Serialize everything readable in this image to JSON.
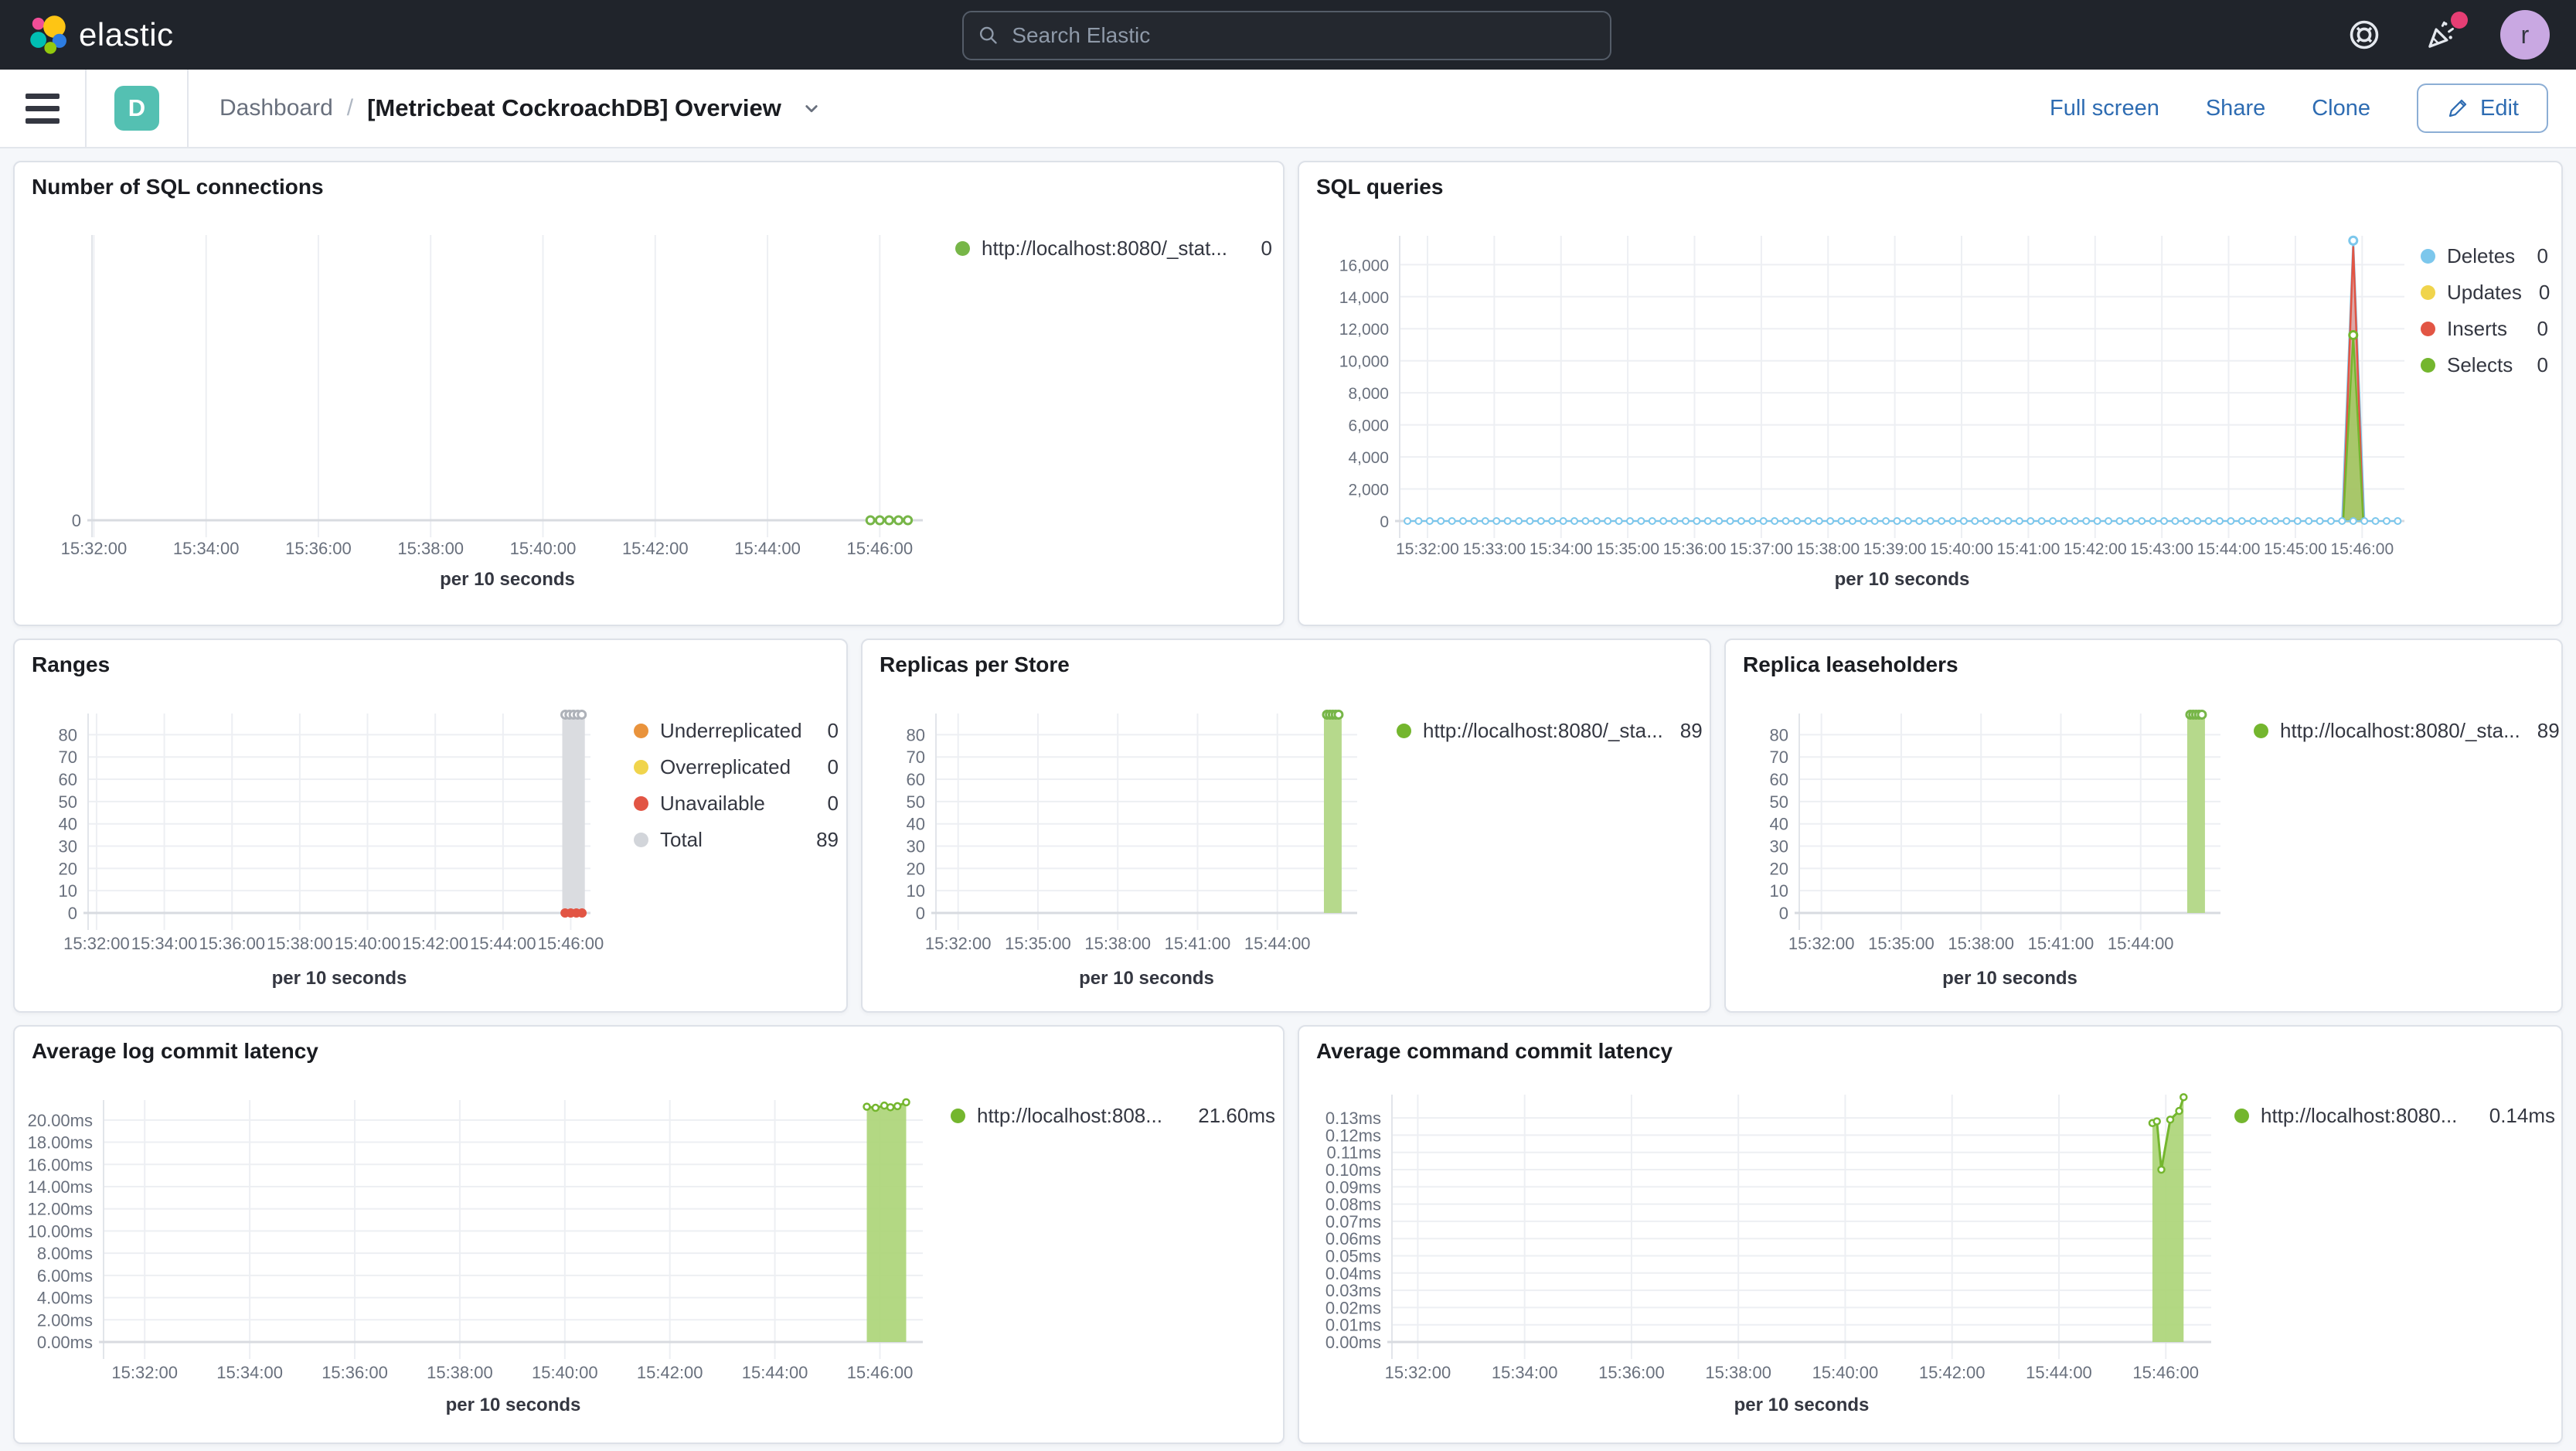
{
  "header": {
    "logo_text": "elastic",
    "search_placeholder": "Search Elastic",
    "avatar_initial": "r"
  },
  "toolbar": {
    "breadcrumb_root": "Dashboard",
    "breadcrumb_sep": "/",
    "dashboard_badge": "D",
    "title": "[Metricbeat CockroachDB] Overview",
    "actions": {
      "full_screen": "Full screen",
      "share": "Share",
      "clone": "Clone",
      "edit": "Edit"
    }
  },
  "colors": {
    "header_bg": "#20242B",
    "accent_teal": "#54C0B2",
    "link_blue": "#2E6CB2",
    "series_green": "#77B648",
    "series_green_fill": "#B6D98C",
    "series_blue": "#7CC7EC",
    "series_yellow": "#F0D44C",
    "series_red": "#E25544",
    "series_orange": "#E9933C",
    "series_gray": "#D2D5DA",
    "notification_pink": "#E63E74",
    "avatar_purple": "#C9A8E2"
  },
  "panels": [
    {
      "id": "sql_connections",
      "row": 0,
      "title": "Number of SQL connections",
      "x_title": "per 10 seconds",
      "chart": {
        "type": "line",
        "x_domain": [
          "15:31:58",
          "15:46:46"
        ],
        "x_ticks": [
          "15:32:00",
          "15:34:00",
          "15:36:00",
          "15:38:00",
          "15:40:00",
          "15:42:00",
          "15:44:00",
          "15:46:00"
        ],
        "y_max": 1,
        "y_ticks": [
          {
            "v": 0,
            "label": "0"
          }
        ],
        "series": [
          {
            "name": "http://localhost:8080/_stat...",
            "type": "scatter",
            "color": "#77B648",
            "ring": true,
            "points": [
              [
                "15:45:50",
                0
              ],
              [
                "15:46:00",
                0
              ],
              [
                "15:46:10",
                0
              ],
              [
                "15:46:20",
                0
              ],
              [
                "15:46:30",
                0
              ]
            ]
          }
        ]
      },
      "legend": [
        {
          "label": "http://localhost:8080/_stat...",
          "color": "#77B648",
          "value": "0"
        }
      ]
    },
    {
      "id": "sql_queries",
      "row": 0,
      "title": "SQL queries",
      "x_title": "per 10 seconds",
      "chart": {
        "type": "line",
        "x_domain": [
          "15:31:35",
          "15:46:38"
        ],
        "x_ticks": [
          "15:32:00",
          "15:33:00",
          "15:34:00",
          "15:35:00",
          "15:36:00",
          "15:37:00",
          "15:38:00",
          "15:39:00",
          "15:40:00",
          "15:41:00",
          "15:42:00",
          "15:43:00",
          "15:44:00",
          "15:45:00",
          "15:46:00"
        ],
        "y_max": 17800,
        "y_ticks": [
          {
            "v": 0,
            "label": "0"
          },
          {
            "v": 2000,
            "label": "2,000"
          },
          {
            "v": 4000,
            "label": "4,000"
          },
          {
            "v": 6000,
            "label": "6,000"
          },
          {
            "v": 8000,
            "label": "8,000"
          },
          {
            "v": 10000,
            "label": "10,000"
          },
          {
            "v": 12000,
            "label": "12,000"
          },
          {
            "v": 14000,
            "label": "14,000"
          },
          {
            "v": 16000,
            "label": "16,000"
          }
        ],
        "series": [
          {
            "name": "Deletes spike",
            "type": "spike",
            "stroke": "#7CC7EC",
            "fill": "#7CC7EC",
            "fill_opacity": 0.3,
            "start": "15:45:42",
            "peak_t": "15:45:52",
            "end": "15:46:02",
            "peak": 17500,
            "marker": true
          },
          {
            "name": "Inserts",
            "type": "spike",
            "stroke": "#E25544",
            "fill": "#E25544",
            "fill_opacity": 0.45,
            "start": "15:45:43",
            "peak_t": "15:45:52",
            "end": "15:46:01",
            "peak": 17100,
            "marker": false
          },
          {
            "name": "Selects",
            "type": "spike",
            "stroke": "#74B62E",
            "fill": "#9FCC5F",
            "fill_opacity": 0.85,
            "start": "15:45:43",
            "peak_t": "15:45:52",
            "end": "15:46:01",
            "peak": 11600,
            "marker": true
          },
          {
            "name": "Deletes baseline",
            "type": "dotline",
            "color": "#7CC7EC",
            "value": 0,
            "from": "15:31:42",
            "to": "15:46:34",
            "step_s": 10
          }
        ]
      },
      "legend": [
        {
          "label": "Deletes",
          "color": "#7CC7EC",
          "value": "0"
        },
        {
          "label": "Updates",
          "color": "#F0D44C",
          "value": "0"
        },
        {
          "label": "Inserts",
          "color": "#E25544",
          "value": "0"
        },
        {
          "label": "Selects",
          "color": "#74B62E",
          "value": "0"
        }
      ]
    },
    {
      "id": "ranges",
      "row": 1,
      "title": "Ranges",
      "x_title": "per 10 seconds",
      "chart": {
        "type": "bar",
        "x_domain": [
          "15:31:45",
          "15:46:35"
        ],
        "x_ticks": [
          "15:32:00",
          "15:34:00",
          "15:36:00",
          "15:38:00",
          "15:40:00",
          "15:42:00",
          "15:44:00",
          "15:46:00"
        ],
        "y_max": 89.5,
        "y_ticks": [
          {
            "v": 0,
            "label": "0"
          },
          {
            "v": 10,
            "label": "10"
          },
          {
            "v": 20,
            "label": "20"
          },
          {
            "v": 30,
            "label": "30"
          },
          {
            "v": 40,
            "label": "40"
          },
          {
            "v": 50,
            "label": "50"
          },
          {
            "v": 60,
            "label": "60"
          },
          {
            "v": 70,
            "label": "70"
          },
          {
            "v": 80,
            "label": "80"
          }
        ],
        "series": [
          {
            "name": "Total",
            "type": "bar",
            "color": "#DADCE0",
            "x_from": "15:45:45",
            "x_to": "15:46:25",
            "value": 89,
            "top_markers": {
              "count": 5,
              "color": "#AEB2B9"
            }
          },
          {
            "name": "Unavailable",
            "type": "scatter",
            "color": "#E25544",
            "solid": true,
            "points": [
              [
                "15:45:50",
                0
              ],
              [
                "15:46:00",
                0
              ],
              [
                "15:46:10",
                0
              ],
              [
                "15:46:20",
                0
              ]
            ]
          }
        ]
      },
      "legend": [
        {
          "label": "Underreplicated",
          "color": "#E9933C",
          "value": "0"
        },
        {
          "label": "Overreplicated",
          "color": "#F0D44C",
          "value": "0"
        },
        {
          "label": "Unavailable",
          "color": "#E25544",
          "value": "0"
        },
        {
          "label": "Total",
          "color": "#D2D5DA",
          "value": "89"
        }
      ]
    },
    {
      "id": "replicas",
      "row": 1,
      "title": "Replicas per Store",
      "x_title": "per 10 seconds",
      "chart": {
        "type": "bar",
        "x_domain": [
          "15:31:10",
          "15:47:00"
        ],
        "x_ticks": [
          "15:32:00",
          "15:35:00",
          "15:38:00",
          "15:41:00",
          "15:44:00"
        ],
        "y_max": 89.5,
        "y_ticks": [
          {
            "v": 0,
            "label": "0"
          },
          {
            "v": 10,
            "label": "10"
          },
          {
            "v": 20,
            "label": "20"
          },
          {
            "v": 30,
            "label": "30"
          },
          {
            "v": 40,
            "label": "40"
          },
          {
            "v": 50,
            "label": "50"
          },
          {
            "v": 60,
            "label": "60"
          },
          {
            "v": 70,
            "label": "70"
          },
          {
            "v": 80,
            "label": "80"
          }
        ],
        "series": [
          {
            "name": "http://localhost:8080/_sta...",
            "type": "bar",
            "color": "#B6D98C",
            "x_from": "15:45:45",
            "x_to": "15:46:25",
            "value": 89,
            "top_markers": {
              "count": 5,
              "color": "#77B648"
            }
          }
        ]
      },
      "legend": [
        {
          "label": "http://localhost:8080/_sta...",
          "color": "#74B62E",
          "value": "89"
        }
      ]
    },
    {
      "id": "leaseholders",
      "row": 1,
      "title": "Replica leaseholders",
      "x_title": "per 10 seconds",
      "chart": {
        "type": "bar",
        "x_domain": [
          "15:31:10",
          "15:47:00"
        ],
        "x_ticks": [
          "15:32:00",
          "15:35:00",
          "15:38:00",
          "15:41:00",
          "15:44:00"
        ],
        "y_max": 89.5,
        "y_ticks": [
          {
            "v": 0,
            "label": "0"
          },
          {
            "v": 10,
            "label": "10"
          },
          {
            "v": 20,
            "label": "20"
          },
          {
            "v": 30,
            "label": "30"
          },
          {
            "v": 40,
            "label": "40"
          },
          {
            "v": 50,
            "label": "50"
          },
          {
            "v": 60,
            "label": "60"
          },
          {
            "v": 70,
            "label": "70"
          },
          {
            "v": 80,
            "label": "80"
          }
        ],
        "series": [
          {
            "name": "http://localhost:8080/_sta...",
            "type": "bar",
            "color": "#B6D98C",
            "x_from": "15:45:45",
            "x_to": "15:46:25",
            "value": 89,
            "top_markers": {
              "count": 5,
              "color": "#77B648"
            }
          }
        ]
      },
      "legend": [
        {
          "label": "http://localhost:8080/_sta...",
          "color": "#74B62E",
          "value": "89"
        }
      ]
    },
    {
      "id": "log_latency",
      "row": 2,
      "title": "Average log commit latency",
      "x_title": "per 10 seconds",
      "chart": {
        "type": "area",
        "x_domain": [
          "15:31:13",
          "15:46:49"
        ],
        "x_ticks": [
          "15:32:00",
          "15:34:00",
          "15:36:00",
          "15:38:00",
          "15:40:00",
          "15:42:00",
          "15:44:00",
          "15:46:00"
        ],
        "y_max": 21.8,
        "y_ticks": [
          {
            "v": 0,
            "label": "0.00ms"
          },
          {
            "v": 2,
            "label": "2.00ms"
          },
          {
            "v": 4,
            "label": "4.00ms"
          },
          {
            "v": 6,
            "label": "6.00ms"
          },
          {
            "v": 8,
            "label": "8.00ms"
          },
          {
            "v": 10,
            "label": "10.00ms"
          },
          {
            "v": 12,
            "label": "12.00ms"
          },
          {
            "v": 14,
            "label": "14.00ms"
          },
          {
            "v": 16,
            "label": "16.00ms"
          },
          {
            "v": 18,
            "label": "18.00ms"
          },
          {
            "v": 20,
            "label": "20.00ms"
          }
        ],
        "series": [
          {
            "name": "http://localhost:808...",
            "type": "area_line",
            "stroke": "#74B62E",
            "fill": "#ABD476",
            "fill_opacity": 0.9,
            "ring": true,
            "points": [
              [
                "15:45:45",
                21.2
              ],
              [
                "15:45:55",
                21.1
              ],
              [
                "15:46:05",
                21.3
              ],
              [
                "15:46:12",
                21.15
              ],
              [
                "15:46:20",
                21.25
              ],
              [
                "15:46:30",
                21.6
              ]
            ]
          }
        ]
      },
      "legend": [
        {
          "label": "http://localhost:808...",
          "color": "#74B62E",
          "value": "21.60ms"
        }
      ]
    },
    {
      "id": "cmd_latency",
      "row": 2,
      "title": "Average command commit latency",
      "x_title": "per 10 seconds",
      "chart": {
        "type": "area",
        "x_domain": [
          "15:31:31",
          "15:46:51"
        ],
        "x_ticks": [
          "15:32:00",
          "15:34:00",
          "15:36:00",
          "15:38:00",
          "15:40:00",
          "15:42:00",
          "15:44:00",
          "15:46:00"
        ],
        "y_max": 0.1435,
        "y_ticks": [
          {
            "v": 0,
            "label": "0.00ms"
          },
          {
            "v": 0.01,
            "label": "0.01ms"
          },
          {
            "v": 0.02,
            "label": "0.02ms"
          },
          {
            "v": 0.03,
            "label": "0.03ms"
          },
          {
            "v": 0.04,
            "label": "0.04ms"
          },
          {
            "v": 0.05,
            "label": "0.05ms"
          },
          {
            "v": 0.06,
            "label": "0.06ms"
          },
          {
            "v": 0.07,
            "label": "0.07ms"
          },
          {
            "v": 0.08,
            "label": "0.08ms"
          },
          {
            "v": 0.09,
            "label": "0.09ms"
          },
          {
            "v": 0.1,
            "label": "0.10ms"
          },
          {
            "v": 0.11,
            "label": "0.11ms"
          },
          {
            "v": 0.12,
            "label": "0.12ms"
          },
          {
            "v": 0.13,
            "label": "0.13ms"
          }
        ],
        "series": [
          {
            "name": "http://localhost:8080...",
            "type": "area_line",
            "stroke": "#74B62E",
            "fill": "#ABD476",
            "fill_opacity": 0.9,
            "ring": true,
            "points": [
              [
                "15:45:45",
                0.127
              ],
              [
                "15:45:50",
                0.128
              ],
              [
                "15:45:55",
                0.1
              ],
              [
                "15:46:05",
                0.129
              ],
              [
                "15:46:15",
                0.134
              ],
              [
                "15:46:20",
                0.142
              ]
            ]
          }
        ]
      },
      "legend": [
        {
          "label": "http://localhost:8080...",
          "color": "#74B62E",
          "value": "0.14ms"
        }
      ]
    }
  ]
}
